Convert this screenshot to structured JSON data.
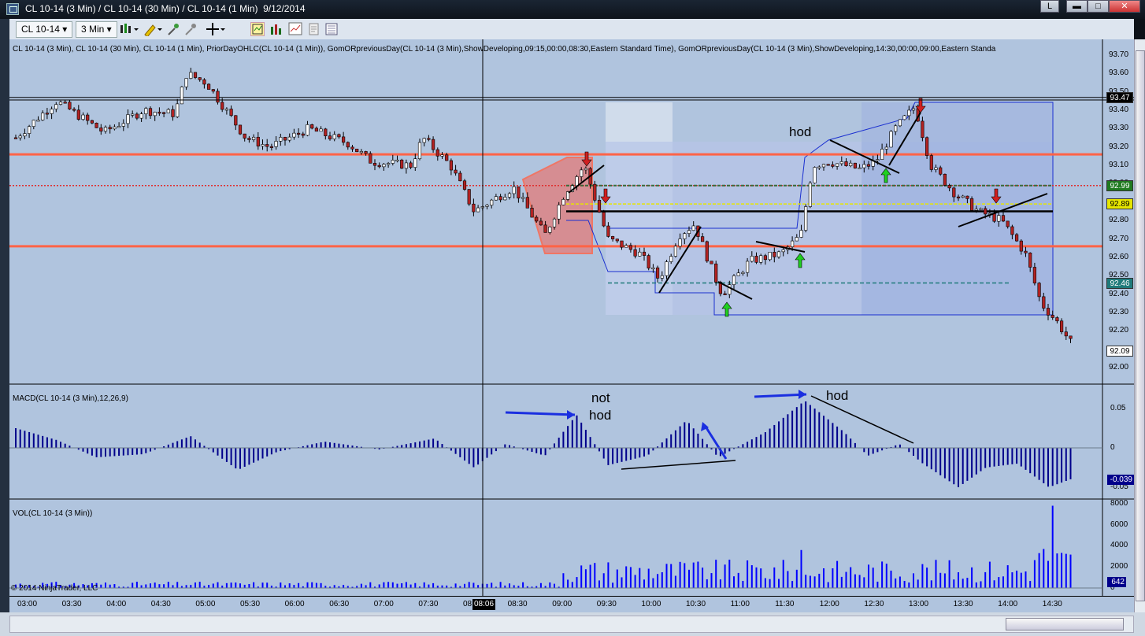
{
  "window": {
    "title": "CL 10-14 (3 Min) / CL 10-14 (30 Min) / CL 10-14 (1 Min)  9/12/2014",
    "btn_l": "L",
    "btn_min": "▬",
    "btn_max": "□",
    "btn_close": "✕"
  },
  "toolbar": {
    "instrument": "CL 10-14",
    "interval": "3 Min"
  },
  "price_pane": {
    "label": "CL 10-14 (3 Min), CL 10-14 (30 Min), CL 10-14 (1 Min), PriorDayOHLC(CL 10-14 (1 Min)), GomORpreviousDay(CL 10-14 (3 Min),ShowDeveloping,09:15,00:00,08:30,Eastern Standard Time), GomORpreviousDay(CL 10-14 (3 Min),ShowDeveloping,14:30,00:00,09:00,Eastern Standa",
    "ticks": [
      "93.70",
      "93.60",
      "93.50",
      "93.40",
      "93.30",
      "93.20",
      "93.10",
      "93.00",
      "92.90",
      "92.80",
      "92.70",
      "92.60",
      "92.50",
      "92.40",
      "92.30",
      "92.20",
      "92.10",
      "92.00"
    ],
    "markers": [
      {
        "text": "93.47",
        "color": "#000000"
      },
      {
        "text": "92.99",
        "color": "#1f7a1f"
      },
      {
        "text": "92.89",
        "color": "#e6e600"
      },
      {
        "text": "92.46",
        "color": "#1f7a7a"
      },
      {
        "text": "92.09",
        "color": "#ffffff"
      }
    ],
    "annotation_hod": "hod"
  },
  "macd_pane": {
    "label": "MACD(CL 10-14 (3 Min),12,26,9)",
    "ticks": [
      "0.05",
      "0",
      "-0.05"
    ],
    "marker": "-0.039",
    "annotation_not": "not",
    "annotation_hod1": "hod",
    "annotation_hod2": "hod"
  },
  "vol_pane": {
    "label": "VOL(CL 10-14 (3 Min))",
    "ticks": [
      "8000",
      "6000",
      "4000",
      "2000",
      "0"
    ],
    "marker": "642",
    "copyright": "© 2014 NinjaTrader, LLC"
  },
  "x_axis": {
    "labels": [
      "03:00",
      "03:30",
      "04:00",
      "04:30",
      "05:00",
      "05:30",
      "06:00",
      "06:30",
      "07:00",
      "07:30",
      "08",
      "08:30",
      "09:00",
      "09:30",
      "10:00",
      "10:30",
      "11:00",
      "11:30",
      "12:00",
      "12:30",
      "13:00",
      "13:30",
      "14:00",
      "14:30"
    ],
    "cursor_label": "08:06"
  },
  "colors": {
    "background": "#b0c4de",
    "bull_candle": "#ffffff",
    "bear_candle": "#b22222",
    "level_red": "#ff6347",
    "macd_bar": "#00008b",
    "volume_bar": "#0000ff"
  }
}
